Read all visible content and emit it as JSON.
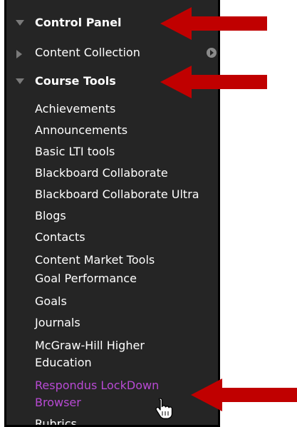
{
  "control_panel": {
    "label": "Control Panel"
  },
  "content_collection": {
    "label": "Content Collection"
  },
  "course_tools": {
    "label": "Course Tools",
    "items": [
      "Achievements",
      "Announcements",
      "Basic LTI tools",
      "Blackboard Collaborate",
      "Blackboard Collaborate Ultra",
      "Blogs",
      "Contacts",
      "Content Market Tools",
      "Goal Performance",
      "Goals",
      "Journals",
      "McGraw-Hill Higher",
      "Education",
      "Respondus LockDown",
      "Browser",
      "Rubrics"
    ],
    "active_item": "Respondus LockDown Browser"
  },
  "colors": {
    "panel_bg": "#252525",
    "text": "#ffffff",
    "active": "#b84ad4",
    "arrow": "#c00000",
    "expand_icon": "#7a7a7a"
  },
  "icons": [
    "expand-down-icon",
    "expand-right-icon",
    "go-arrow-icon",
    "hand-cursor-icon",
    "annotation-arrow"
  ]
}
